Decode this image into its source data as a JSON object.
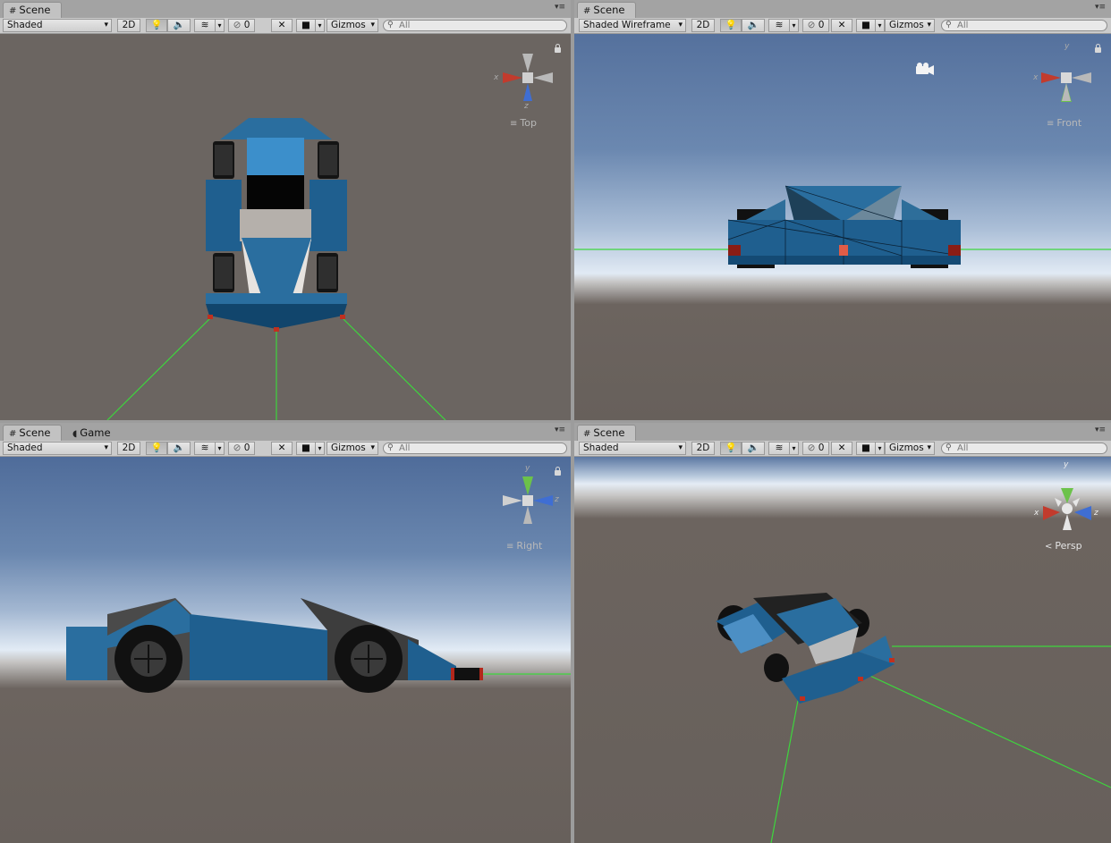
{
  "panels": {
    "top": {
      "tabs": [
        "Scene"
      ],
      "shading": "Shaded",
      "view": "Top",
      "count": "0",
      "search_placeholder": "All",
      "axes": {
        "x": "x",
        "z": "z"
      }
    },
    "front": {
      "tabs": [
        "Scene"
      ],
      "shading": "Shaded Wireframe",
      "view": "Front",
      "count": "0",
      "search_placeholder": "All",
      "axes": {
        "x": "x",
        "y": "y"
      }
    },
    "right": {
      "tabs": [
        "Scene",
        "Game"
      ],
      "shading": "Shaded",
      "view": "Right",
      "count": "0",
      "search_placeholder": "All",
      "axes": {
        "y": "y",
        "z": "z"
      }
    },
    "persp": {
      "tabs": [
        "Scene"
      ],
      "shading": "Shaded",
      "view": "Persp",
      "count": "0",
      "search_placeholder": "All",
      "axes": {
        "x": "x",
        "y": "y",
        "z": "z"
      }
    }
  },
  "toolbar": {
    "twod_label": "2D",
    "gizmos_label": "Gizmos"
  },
  "icons": {
    "scene_tab": "grid-hash-icon",
    "game_tab": "pacman-icon",
    "lighting": "bulb-icon",
    "audio": "speaker-icon",
    "effects": "layers-icon",
    "hidden": "eye-slash-icon",
    "tools": "wrench-icon",
    "camera": "camera-icon",
    "search": "search-icon",
    "menu": "panel-menu-icon",
    "lock": "lock-icon"
  },
  "colors": {
    "car_blue": "#2a6d9c",
    "car_dark": "#0f3a5c",
    "ground": "#6c645f",
    "sky_top": "#4f6c9a",
    "sky_horizon": "#dfe8f3",
    "guide_green": "#33d233",
    "axis_x": "#c83a2c",
    "axis_y": "#6cc24a",
    "axis_z": "#3f6ed3"
  }
}
